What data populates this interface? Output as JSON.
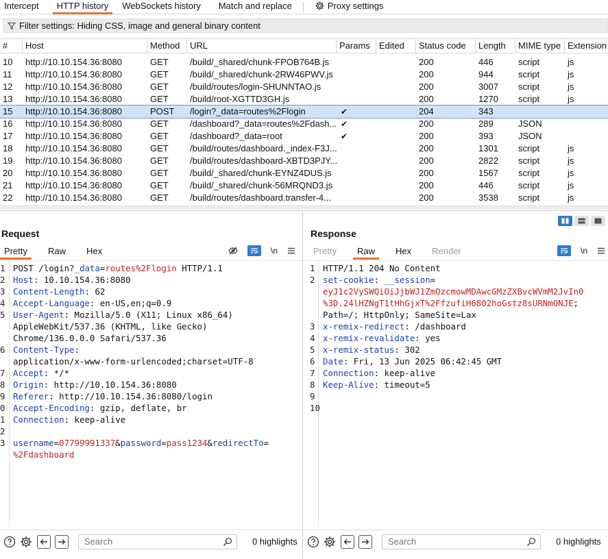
{
  "top_tabs": [
    {
      "label": "Intercept"
    },
    {
      "label": "HTTP history"
    },
    {
      "label": "WebSockets history"
    },
    {
      "label": "Match and replace"
    },
    {
      "label": "Proxy settings"
    }
  ],
  "filter": {
    "label": "Filter settings: Hiding CSS, image and general binary content"
  },
  "columns": [
    "#",
    "Host",
    "Method",
    "URL",
    "Params",
    "Edited",
    "Status code",
    "Length",
    "MIME type",
    "Extension"
  ],
  "rows": [
    {
      "num": "10",
      "host": "http://10.10.154.36:8080",
      "method": "GET",
      "url": "/build/_shared/chunk-FPOB764B.js",
      "params": "",
      "edited": "",
      "status": "200",
      "length": "446",
      "mime": "script",
      "ext": "js"
    },
    {
      "num": "11",
      "host": "http://10.10.154.36:8080",
      "method": "GET",
      "url": "/build/_shared/chunk-2RW46PWV.js",
      "params": "",
      "edited": "",
      "status": "200",
      "length": "944",
      "mime": "script",
      "ext": "js"
    },
    {
      "num": "12",
      "host": "http://10.10.154.36:8080",
      "method": "GET",
      "url": "/build/routes/login-SHUNNTAO.js",
      "params": "",
      "edited": "",
      "status": "200",
      "length": "3007",
      "mime": "script",
      "ext": "js"
    },
    {
      "num": "13",
      "host": "http://10.10.154.36:8080",
      "method": "GET",
      "url": "/build/root-XGTTD3GH.js",
      "params": "",
      "edited": "",
      "status": "200",
      "length": "1270",
      "mime": "script",
      "ext": "js"
    },
    {
      "num": "15",
      "host": "http://10.10.154.36:8080",
      "method": "POST",
      "url": "/login?_data=routes%2Flogin",
      "params": "✔",
      "edited": "",
      "status": "204",
      "length": "343",
      "mime": "",
      "ext": ""
    },
    {
      "num": "16",
      "host": "http://10.10.154.36:8080",
      "method": "GET",
      "url": "/dashboard?_data=routes%2Fdash...",
      "params": "✔",
      "edited": "",
      "status": "200",
      "length": "289",
      "mime": "JSON",
      "ext": ""
    },
    {
      "num": "17",
      "host": "http://10.10.154.36:8080",
      "method": "GET",
      "url": "/dashboard?_data=root",
      "params": "✔",
      "edited": "",
      "status": "200",
      "length": "393",
      "mime": "JSON",
      "ext": ""
    },
    {
      "num": "18",
      "host": "http://10.10.154.36:8080",
      "method": "GET",
      "url": "/build/routes/dashboard._index-F3J...",
      "params": "",
      "edited": "",
      "status": "200",
      "length": "1301",
      "mime": "script",
      "ext": "js"
    },
    {
      "num": "19",
      "host": "http://10.10.154.36:8080",
      "method": "GET",
      "url": "/build/routes/dashboard-XBTD3PJY...",
      "params": "",
      "edited": "",
      "status": "200",
      "length": "2822",
      "mime": "script",
      "ext": "js"
    },
    {
      "num": "20",
      "host": "http://10.10.154.36:8080",
      "method": "GET",
      "url": "/build/_shared/chunk-EYNZ4DUS.js",
      "params": "",
      "edited": "",
      "status": "200",
      "length": "1567",
      "mime": "script",
      "ext": "js"
    },
    {
      "num": "21",
      "host": "http://10.10.154.36:8080",
      "method": "GET",
      "url": "/build/_shared/chunk-56MRQND3.js",
      "params": "",
      "edited": "",
      "status": "200",
      "length": "446",
      "mime": "script",
      "ext": "js"
    },
    {
      "num": "22",
      "host": "http://10.10.154.36:8080",
      "method": "GET",
      "url": "/build/routes/dashboard.transfer-4...",
      "params": "",
      "edited": "",
      "status": "200",
      "length": "3538",
      "mime": "script",
      "ext": "js"
    }
  ],
  "selected_row": "15",
  "request": {
    "title": "Request",
    "tabs": [
      "Pretty",
      "Raw",
      "Hex"
    ],
    "active_tab": "Pretty",
    "newline_label": "\\n",
    "lines": [
      {
        "n": "1",
        "parts": [
          [
            "v",
            "POST /login?"
          ],
          [
            "k",
            "_data"
          ],
          [
            "v",
            "="
          ],
          [
            "r",
            "routes%2Flogin"
          ],
          [
            "v",
            " HTTP/1.1"
          ]
        ]
      },
      {
        "n": "2",
        "parts": [
          [
            "k",
            "Host"
          ],
          [
            "v",
            ": 10.10.154.36:8080"
          ]
        ]
      },
      {
        "n": "3",
        "parts": [
          [
            "k",
            "Content-Length"
          ],
          [
            "v",
            ": 62"
          ]
        ]
      },
      {
        "n": "4",
        "parts": [
          [
            "k",
            "Accept-Language"
          ],
          [
            "v",
            ": en-US,en;q=0.9"
          ]
        ]
      },
      {
        "n": "5",
        "parts": [
          [
            "k",
            "User-Agent"
          ],
          [
            "v",
            ": Mozilla/5.0 (X11; Linux x86_64)"
          ]
        ]
      },
      {
        "n": "",
        "parts": [
          [
            "v",
            "AppleWebKit/537.36 (KHTML, like Gecko)"
          ]
        ]
      },
      {
        "n": "",
        "parts": [
          [
            "v",
            "Chrome/136.0.0.0 Safari/537.36"
          ]
        ]
      },
      {
        "n": "6",
        "parts": [
          [
            "k",
            "Content-Type"
          ],
          [
            "v",
            ":"
          ]
        ]
      },
      {
        "n": "",
        "parts": [
          [
            "v",
            "application/x-www-form-urlencoded;charset=UTF-8"
          ]
        ]
      },
      {
        "n": "7",
        "parts": [
          [
            "k",
            "Accept"
          ],
          [
            "v",
            ": */*"
          ]
        ]
      },
      {
        "n": "8",
        "parts": [
          [
            "k",
            "Origin"
          ],
          [
            "v",
            ": http://10.10.154.36:8080"
          ]
        ]
      },
      {
        "n": "9",
        "parts": [
          [
            "k",
            "Referer"
          ],
          [
            "v",
            ": http://10.10.154.36:8080/login"
          ]
        ]
      },
      {
        "n": "0",
        "parts": [
          [
            "k",
            "Accept-Encoding"
          ],
          [
            "v",
            ": gzip, deflate, br"
          ]
        ]
      },
      {
        "n": "1",
        "parts": [
          [
            "k",
            "Connection"
          ],
          [
            "v",
            ": keep-alive"
          ]
        ]
      },
      {
        "n": "2",
        "parts": []
      },
      {
        "n": "3",
        "parts": [
          [
            "k",
            "username"
          ],
          [
            "v",
            "="
          ],
          [
            "r",
            "07799991337"
          ],
          [
            "v",
            "&"
          ],
          [
            "k",
            "password"
          ],
          [
            "v",
            "="
          ],
          [
            "r",
            "pass1234"
          ],
          [
            "v",
            "&"
          ],
          [
            "k",
            "redirectTo"
          ],
          [
            "v",
            "="
          ]
        ]
      },
      {
        "n": "",
        "parts": [
          [
            "r",
            "%2Fdashboard"
          ]
        ]
      }
    ],
    "search_placeholder": "Search",
    "highlights": "0 highlights"
  },
  "response": {
    "title": "Response",
    "tabs": [
      "Pretty",
      "Raw",
      "Hex",
      "Render"
    ],
    "active_tab": "Raw",
    "newline_label": "\\n",
    "lines": [
      {
        "n": "1",
        "parts": [
          [
            "v",
            "HTTP/1.1 204 No Content"
          ]
        ]
      },
      {
        "n": "2",
        "parts": [
          [
            "k",
            "set-cookie"
          ],
          [
            "v",
            ": "
          ],
          [
            "k",
            "__session"
          ],
          [
            "v",
            "="
          ]
        ]
      },
      {
        "n": "",
        "parts": [
          [
            "r",
            "eyJ1c2VySWQiOiJjbWJ1ZmOzcmowMDAwcGMzZXBvcWVmM2JvIn0"
          ]
        ]
      },
      {
        "n": "",
        "parts": [
          [
            "r",
            "%3D.24lHZNgT1tHhGjxT%2FfzufiH6802hoGstz8sURNmONJE"
          ],
          [
            "v",
            ";"
          ]
        ]
      },
      {
        "n": "",
        "parts": [
          [
            "v",
            "Path=/; HttpOnly; SameSite=Lax"
          ]
        ]
      },
      {
        "n": "3",
        "parts": [
          [
            "k",
            "x-remix-redirect"
          ],
          [
            "v",
            ": /dashboard"
          ]
        ]
      },
      {
        "n": "4",
        "parts": [
          [
            "k",
            "x-remix-revalidate"
          ],
          [
            "v",
            ": yes"
          ]
        ]
      },
      {
        "n": "5",
        "parts": [
          [
            "k",
            "x-remix-status"
          ],
          [
            "v",
            ": 302"
          ]
        ]
      },
      {
        "n": "6",
        "parts": [
          [
            "k",
            "Date"
          ],
          [
            "v",
            ": Fri, 13 Jun 2025 06:42:45 GMT"
          ]
        ]
      },
      {
        "n": "7",
        "parts": [
          [
            "k",
            "Connection"
          ],
          [
            "v",
            ": keep-alive"
          ]
        ]
      },
      {
        "n": "8",
        "parts": [
          [
            "k",
            "Keep-Alive"
          ],
          [
            "v",
            ": timeout=5"
          ]
        ]
      },
      {
        "n": "9",
        "parts": []
      },
      {
        "n": "10",
        "parts": []
      }
    ],
    "search_placeholder": "Search",
    "highlights": "0 highlights"
  },
  "colors": {
    "accent": "#e8702a",
    "selection": "#d2e3f7",
    "key": "#1d3fb0",
    "value_red": "#c41f1f",
    "button_blue": "#2f7ad6"
  }
}
